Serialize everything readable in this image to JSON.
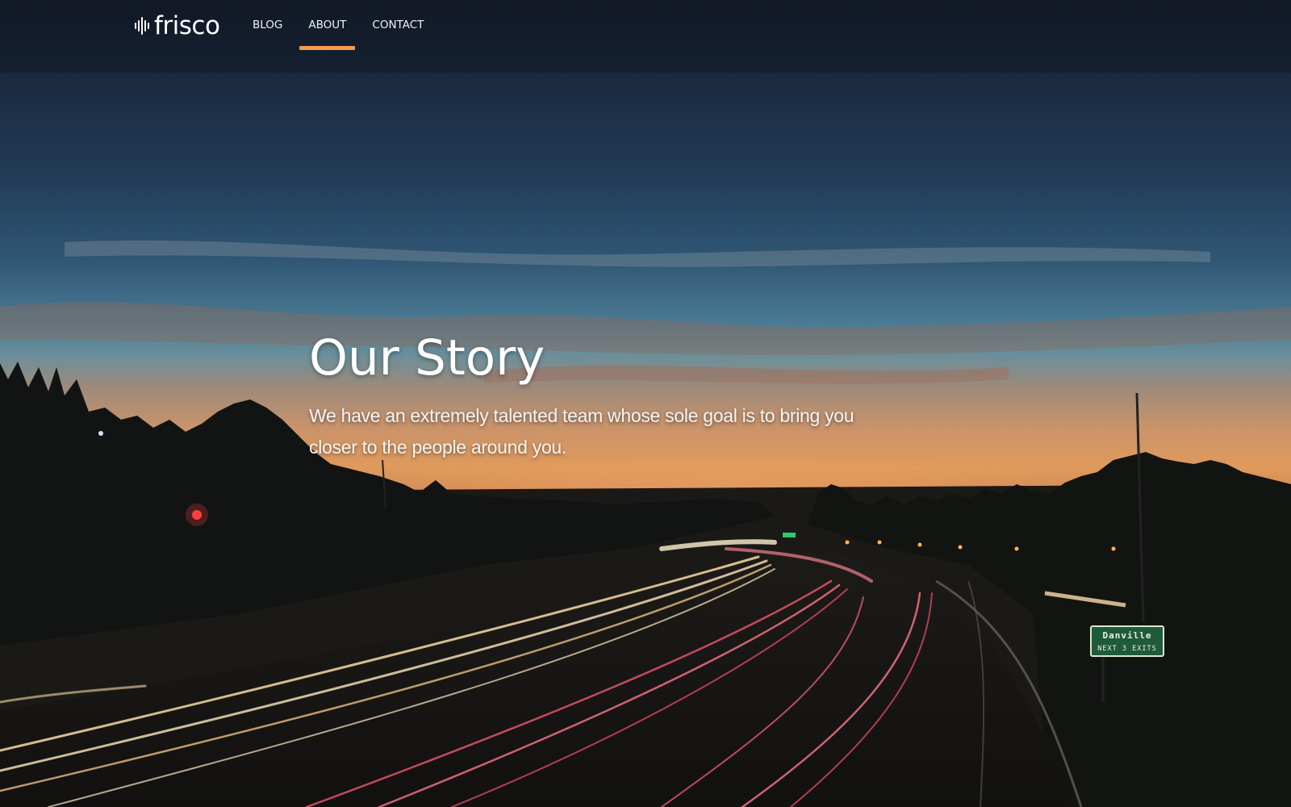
{
  "brand": {
    "name": "frisco",
    "logo_icon": "soundwave-icon",
    "accent_color": "#f39c4a"
  },
  "nav": {
    "items": [
      {
        "label": "BLOG",
        "active": false
      },
      {
        "label": "ABOUT",
        "active": true
      },
      {
        "label": "CONTACT",
        "active": false
      }
    ]
  },
  "hero": {
    "title": "Our Story",
    "subtitle": "We have an extremely talented team whose sole goal is to bring you closer to the people around you.",
    "background": {
      "sign_line1": "Danville",
      "sign_line2": "NEXT 3 EXITS"
    }
  }
}
